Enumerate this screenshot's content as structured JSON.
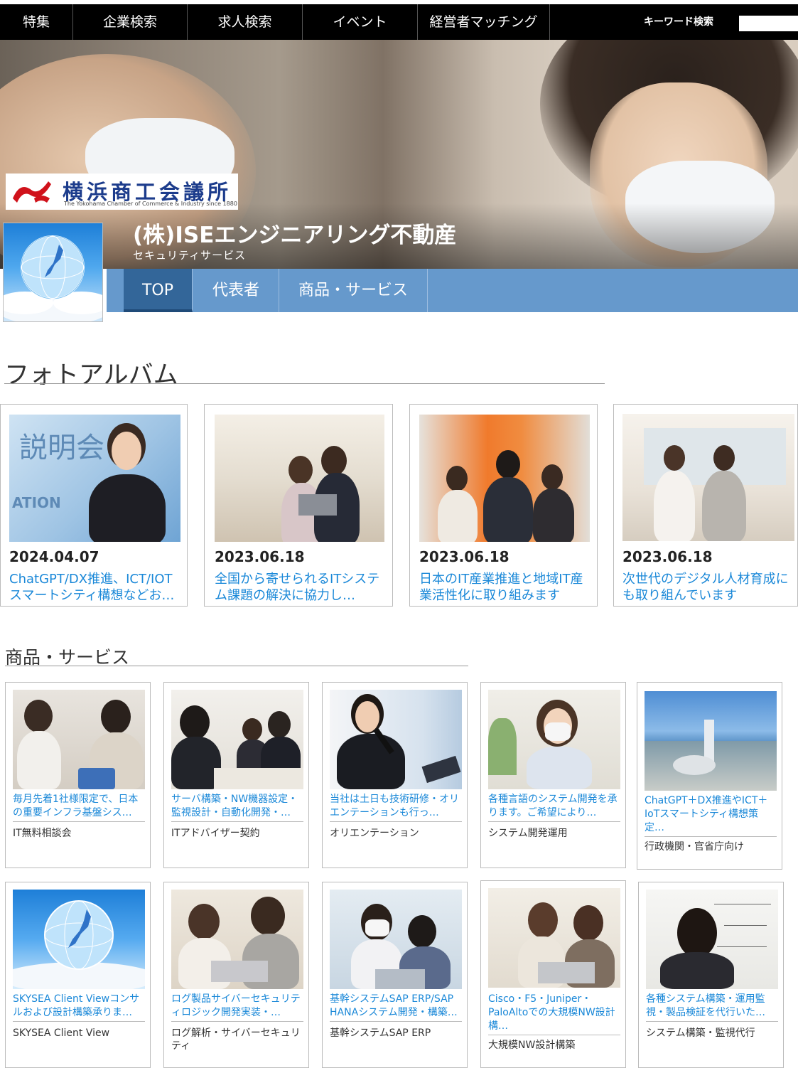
{
  "topnav": {
    "items": [
      "特集",
      "企業検索",
      "求人検索",
      "イベント",
      "経営者マッチング"
    ],
    "keyword_label": "キーワード検索",
    "keyword_value": ""
  },
  "hero": {
    "chamber_name": "横浜商工会議所",
    "chamber_sub": "The Yokohama Chamber of Commerce & Industry since 1880",
    "company_name": "(株)ISEエンジニアリング不動産",
    "company_category": "セキュリティサービス"
  },
  "tabs": [
    "TOP",
    "代表者",
    "商品・サービス"
  ],
  "active_tab": "TOP",
  "album": {
    "title": "フォトアルバム",
    "items": [
      {
        "date": "2024.04.07",
        "caption": "ChatGPT/DX推進、ICT/IOTスマートシティ構想などお…"
      },
      {
        "date": "2023.06.18",
        "caption": "全国から寄せられるITシステム課題の解決に協力し…"
      },
      {
        "date": "2023.06.18",
        "caption": "日本のIT産業推進と地域IT産業活性化に取り組みます"
      },
      {
        "date": "2023.06.18",
        "caption": "次世代のデジタル人材育成にも取り組んでいます"
      }
    ]
  },
  "services": {
    "title": "商品・サービス",
    "items": [
      {
        "caption": "毎月先着1社様限定で、日本の重要インフラ基盤シス…",
        "label": "IT無料相談会"
      },
      {
        "caption": "サーバ構築・NW機器設定・監視設計・自動化開発・…",
        "label": "ITアドバイザー契約"
      },
      {
        "caption": "当社は土日も技術研修・オリエンテーションも行っ…",
        "label": "オリエンテーション"
      },
      {
        "caption": "各種言語のシステム開発を承ります。ご希望により…",
        "label": "システム開発運用"
      },
      {
        "caption": "ChatGPT＋DX推進やICT＋IoTスマートシティ構想策定…",
        "label": "行政機関・官省庁向け"
      },
      {
        "caption": "SKYSEA Client Viewコンサルおよび設計構築承りま…",
        "label": "SKYSEA Client View"
      },
      {
        "caption": "ログ製品サイバーセキュリティロジック開発実装・…",
        "label": "ログ解析・サイバーセキュリティ"
      },
      {
        "caption": "基幹システムSAP ERP/SAP HANAシステム開発・構築…",
        "label": "基幹システムSAP ERP"
      },
      {
        "caption": "Cisco・F5・Juniper・PaloAltoでの大規模NW設計構…",
        "label": "大規模NW設計構築"
      },
      {
        "caption": "各種システム構築・運用監視・製品検証を代行いた…",
        "label": "システム構築・監視代行"
      }
    ]
  },
  "colors": {
    "nav_bg": "#000000",
    "tab_bar": "#6699cc",
    "tab_active": "#336699",
    "link": "#1a88d8"
  }
}
